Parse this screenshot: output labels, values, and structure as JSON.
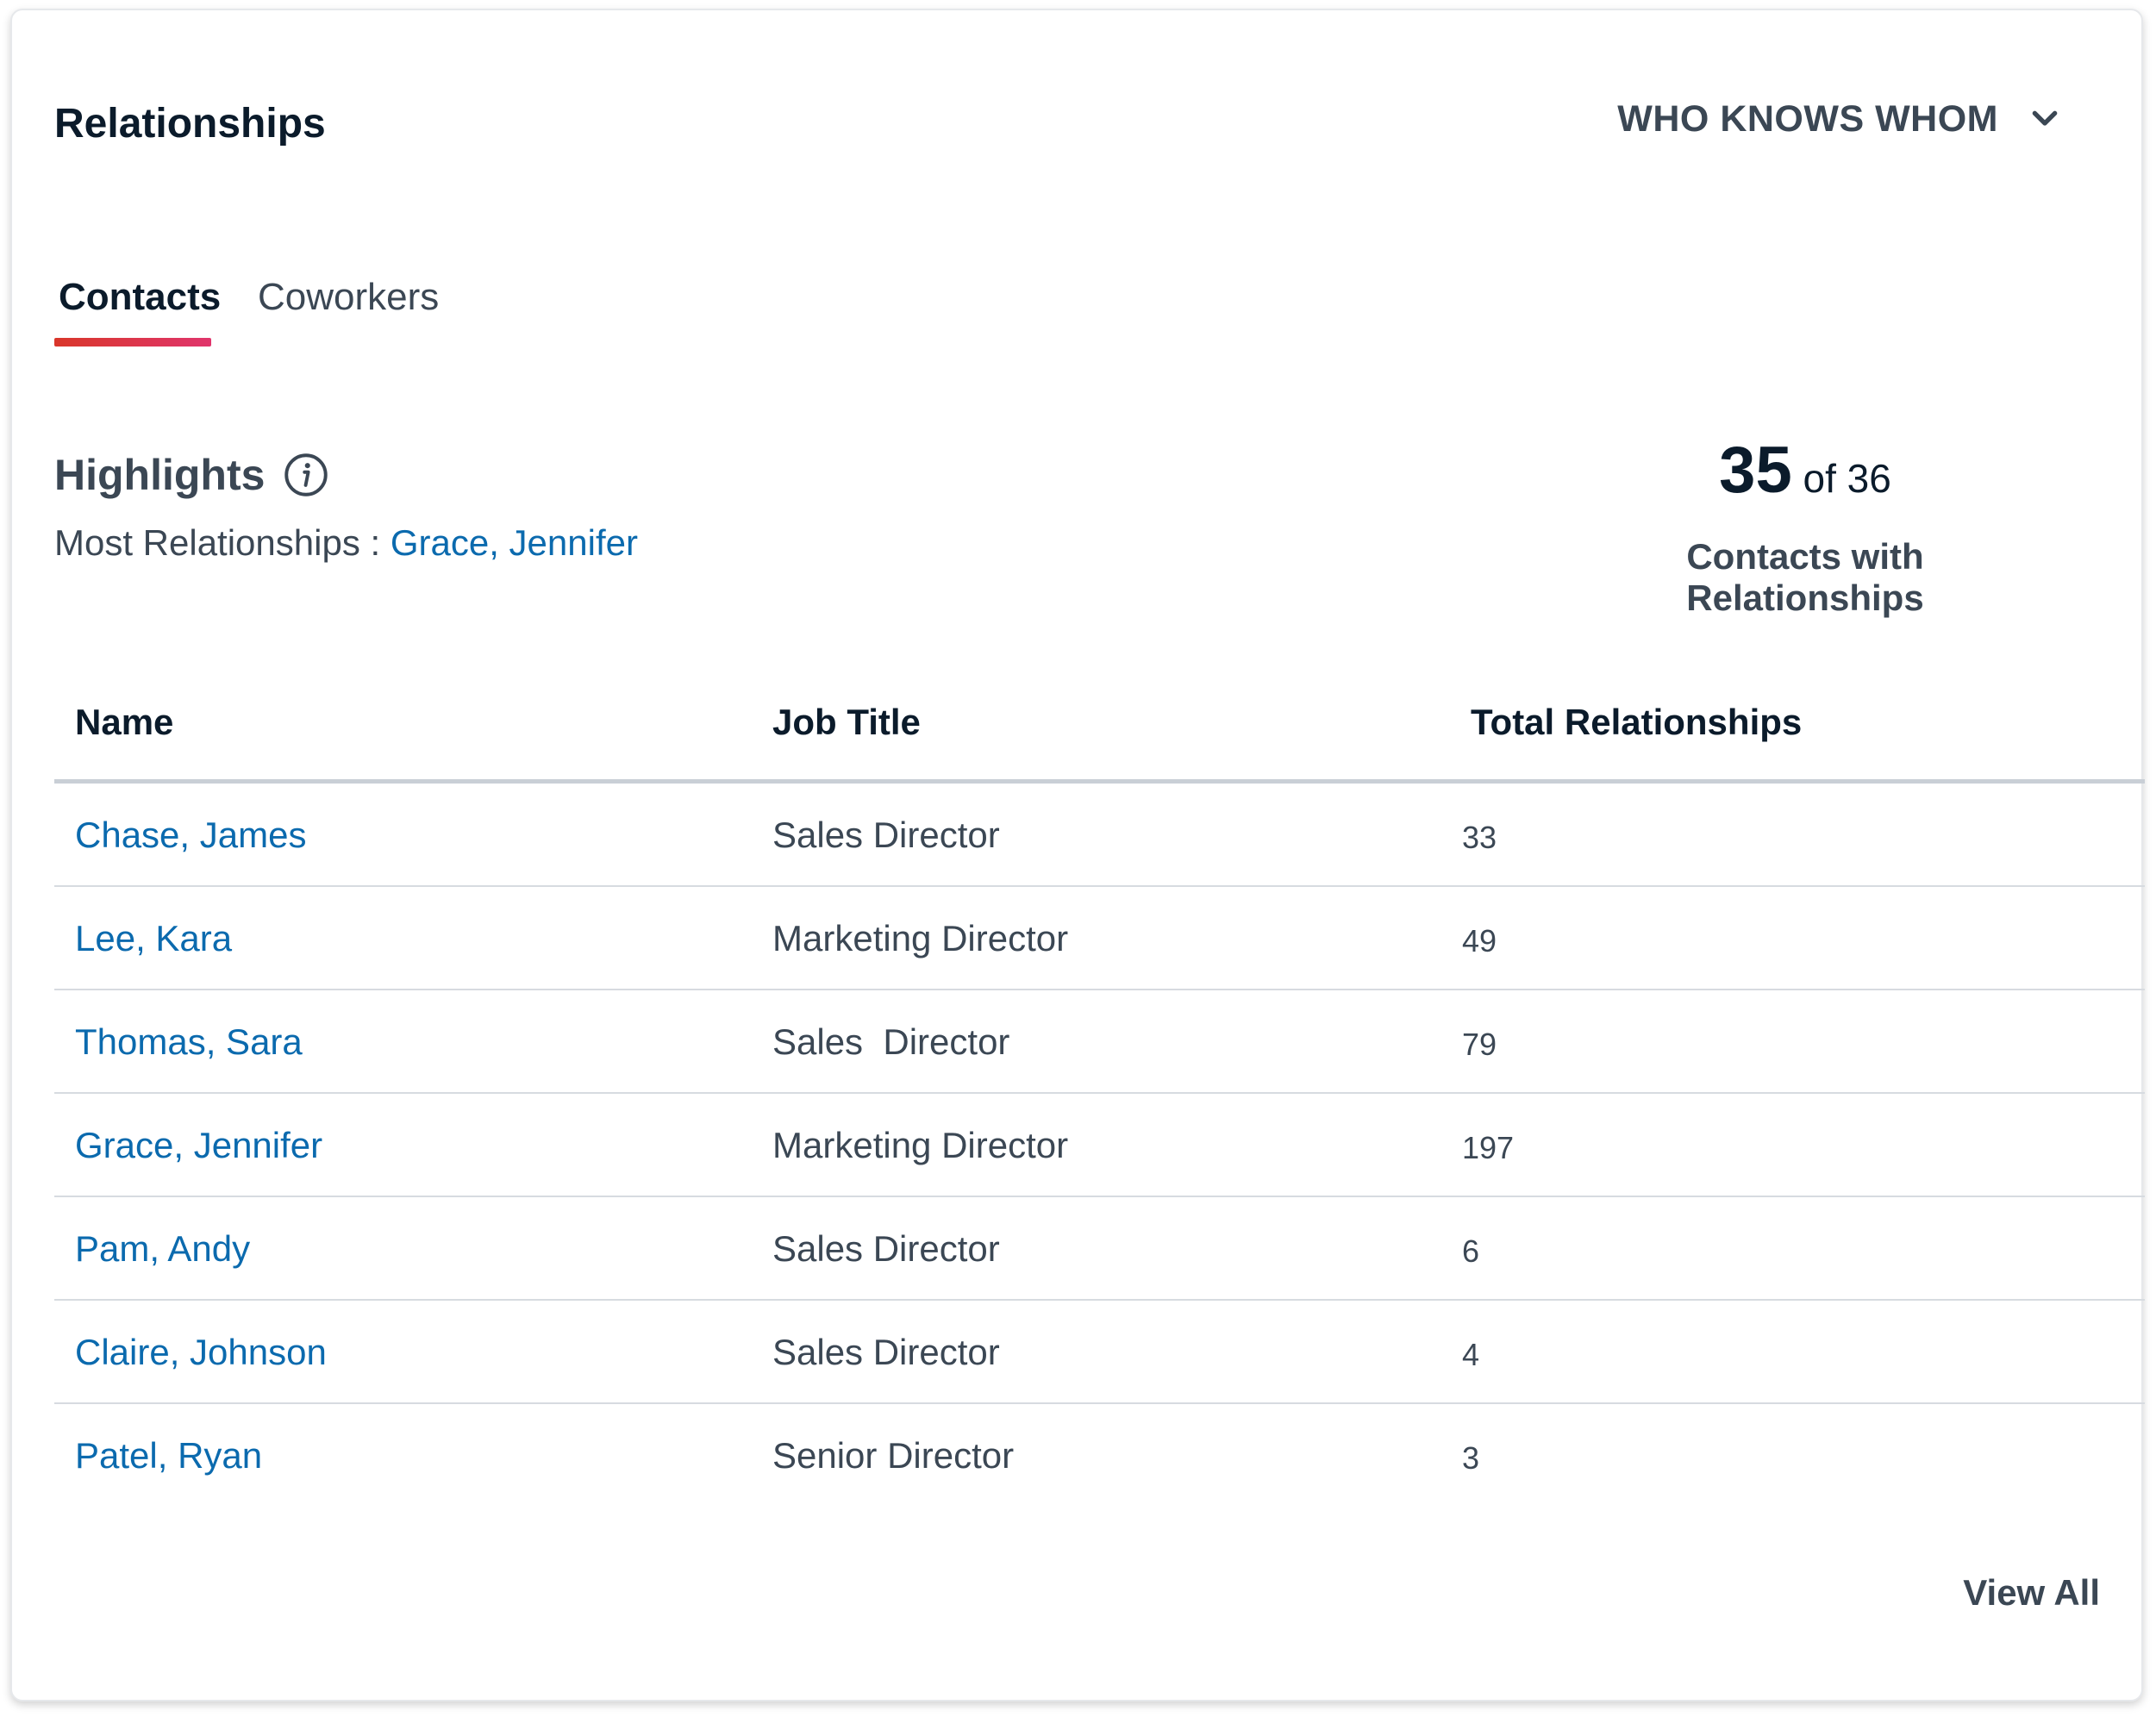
{
  "card": {
    "title": "Relationships"
  },
  "dropdown": {
    "label": "WHO KNOWS WHOM"
  },
  "tabs": [
    {
      "label": "Contacts",
      "active": true
    },
    {
      "label": "Coworkers",
      "active": false
    }
  ],
  "highlights": {
    "title": "Highlights",
    "most_label": "Most Relationships : ",
    "most_value": "Grace, Jennifer"
  },
  "stats": {
    "count": "35",
    "of_text": " of 36",
    "label": "Contacts with Relationships"
  },
  "table": {
    "headers": [
      "Name",
      "Job Title",
      "Total Relationships"
    ],
    "rows": [
      {
        "name": "Chase, James",
        "title": "Sales Director",
        "total": "33"
      },
      {
        "name": "Lee, Kara",
        "title": "Marketing Director",
        "total": "49"
      },
      {
        "name": "Thomas, Sara",
        "title": "Sales  Director",
        "total": "79"
      },
      {
        "name": "Grace, Jennifer",
        "title": "Marketing Director",
        "total": "197"
      },
      {
        "name": "Pam, Andy",
        "title": "Sales Director",
        "total": "6"
      },
      {
        "name": "Claire, Johnson",
        "title": "Sales Director",
        "total": "4"
      },
      {
        "name": "Patel, Ryan",
        "title": "Senior Director",
        "total": "3"
      }
    ]
  },
  "footer": {
    "view_all": "View All"
  },
  "colors": {
    "link": "#0b6aae",
    "tab_underline_start": "#d9362a",
    "tab_underline_end": "#e0356c"
  },
  "icons": {
    "dropdown": "chevron-down-icon",
    "info": "info-icon"
  }
}
